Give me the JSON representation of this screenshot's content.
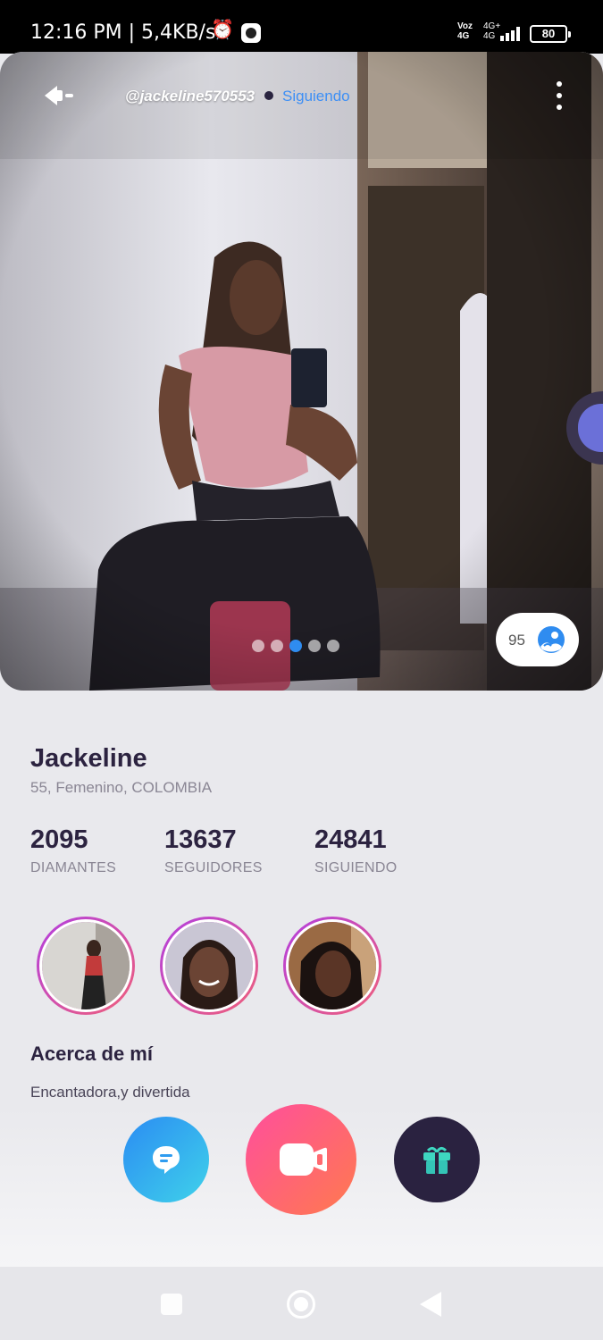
{
  "status_bar": {
    "time": "12:16 PM | 5,4KB/s",
    "alarm_icon": "alarm-clock-icon",
    "app_icon": "app-notification-icon",
    "volte": "Voz\n4G",
    "network": "4G+\n4G",
    "signal_icon": "signal-strength-icon",
    "battery": "80"
  },
  "header": {
    "back_icon": "back-arrow-icon",
    "username": "@jackeline570553",
    "follow_status": "Siguiendo",
    "more_icon": "more-vertical-icon"
  },
  "gallery": {
    "photo_description_icon": "profile-photo",
    "pages": 5,
    "active_page": 3,
    "photo_count": "95",
    "photo_count_icon": "gallery-icon",
    "side_tab_icon": "speaker-icon"
  },
  "profile": {
    "name": "Jackeline",
    "details": "55, Femenino, COLOMBIA"
  },
  "stats": [
    {
      "value": "2095",
      "label": "DIAMANTES"
    },
    {
      "value": "13637",
      "label": "SEGUIDORES"
    },
    {
      "value": "24841",
      "label": "SIGUIENDO"
    }
  ],
  "about": {
    "title": "Acerca de mí",
    "text": "Encantadora,y divertida"
  },
  "actions": {
    "chat_icon": "chat-bubble-icon",
    "video_icon": "video-call-icon",
    "gift_icon": "gift-icon"
  },
  "colors": {
    "accent_blue": "#2f8cf0",
    "follow_blue": "#3d8ff5",
    "video_gradient_start": "#ff4e9d",
    "video_gradient_end": "#ff7a4e",
    "gift_bg": "#2a2240",
    "text_dark": "#2c2340"
  }
}
